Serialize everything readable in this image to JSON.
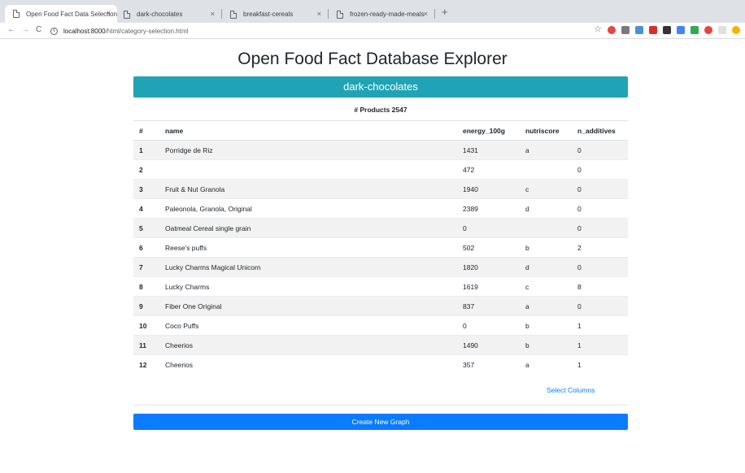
{
  "browser": {
    "tabs": [
      {
        "title": "Open Food Fact Data Selection",
        "active": true
      },
      {
        "title": "dark-chocolates",
        "active": false
      },
      {
        "title": "breakfast-cereals",
        "active": false
      },
      {
        "title": "frozen-ready-made-meals",
        "active": false
      }
    ],
    "close_glyph": "×",
    "new_tab_glyph": "+",
    "nav": {
      "back": "←",
      "forward": "→",
      "reload": "C"
    },
    "url_host": "localhost:8000",
    "url_path": "/html/category-selection.html",
    "extension_colors": [
      "#e8453c",
      "#7a7a7a",
      "#4a90d9",
      "#d93025",
      "#333333",
      "#4285f4",
      "#34a853",
      "#ea4335",
      "#e0e0e0",
      "#f4b400"
    ]
  },
  "page": {
    "title": "Open Food Fact Database Explorer",
    "category": "dark-chocolates",
    "product_count": "# Products 2547",
    "table": {
      "headers": [
        "#",
        "name",
        "energy_100g",
        "nutriscore",
        "n_additives"
      ],
      "rows": [
        [
          "1",
          "Porridge de Riz",
          "1431",
          "a",
          "0"
        ],
        [
          "2",
          "",
          "472",
          "",
          "0"
        ],
        [
          "3",
          "Fruit & Nut Granola",
          "1940",
          "c",
          "0"
        ],
        [
          "4",
          "Paleonola, Granola, Original",
          "2389",
          "d",
          "0"
        ],
        [
          "5",
          "Oatmeal Cereal single grain",
          "0",
          "",
          "0"
        ],
        [
          "6",
          "Reese's puffs",
          "502",
          "b",
          "2"
        ],
        [
          "7",
          "Lucky Charms Magical Unicorn",
          "1820",
          "d",
          "0"
        ],
        [
          "8",
          "Lucky Charms",
          "1619",
          "c",
          "8"
        ],
        [
          "9",
          "Fiber One Original",
          "837",
          "a",
          "0"
        ],
        [
          "10",
          "Coco Puffs",
          "0",
          "b",
          "1"
        ],
        [
          "11",
          "Cheerios",
          "1490",
          "b",
          "1"
        ],
        [
          "12",
          "Cheerios",
          "357",
          "a",
          "1"
        ]
      ]
    },
    "select_columns_label": "Select Columns",
    "create_graph_label": "Create New Graph",
    "colors": {
      "banner": "#20a4b5",
      "button": "#0b7bff",
      "link": "#0d7bff"
    }
  }
}
